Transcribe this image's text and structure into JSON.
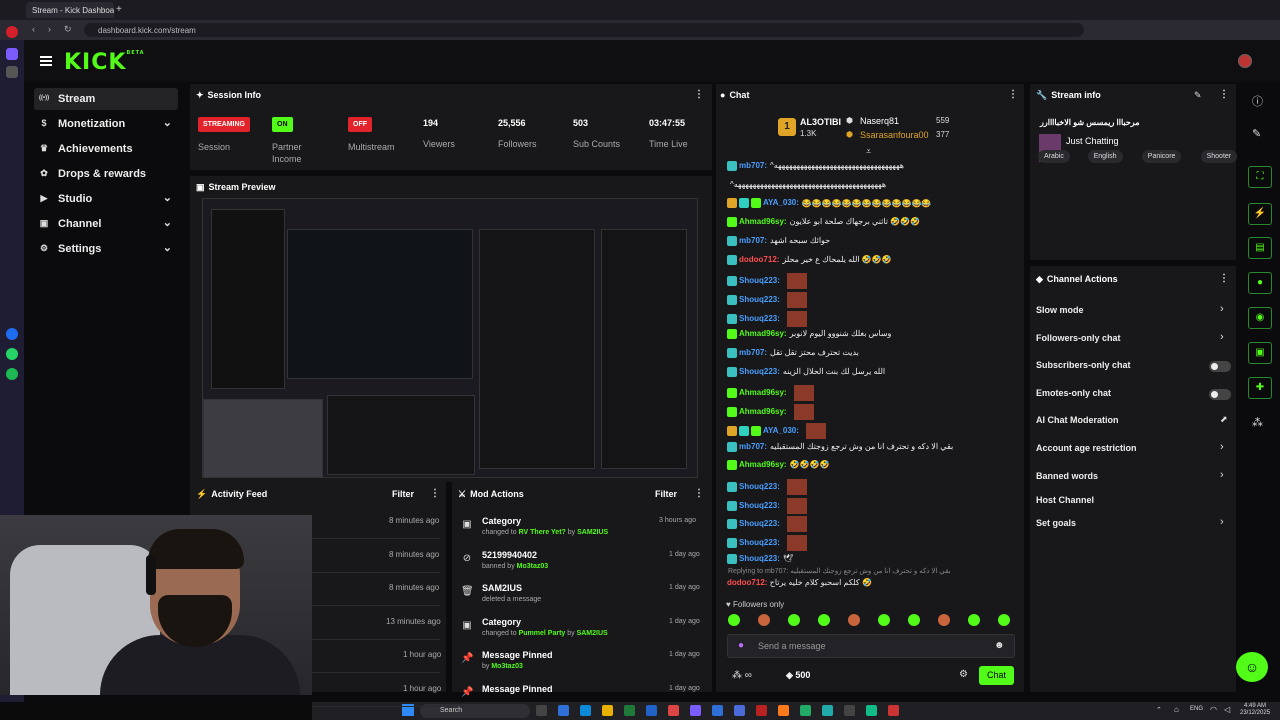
{
  "browser": {
    "tab_title": "Stream - Kick Dashboard",
    "url": "dashboard.kick.com/stream"
  },
  "logo": {
    "text": "KICK",
    "beta": "BETA"
  },
  "nav": [
    {
      "label": "Stream",
      "icon": "stream-icon",
      "active": true
    },
    {
      "label": "Monetization",
      "icon": "dollar-icon",
      "expandable": true
    },
    {
      "label": "Achievements",
      "icon": "trophy-icon"
    },
    {
      "label": "Drops & rewards",
      "icon": "gift-icon"
    },
    {
      "label": "Studio",
      "icon": "studio-icon",
      "expandable": true
    },
    {
      "label": "Channel",
      "icon": "channel-icon",
      "expandable": true
    },
    {
      "label": "Settings",
      "icon": "gear-icon",
      "expandable": true
    }
  ],
  "session": {
    "title": "Session Info",
    "items": [
      {
        "badge": "STREAMING",
        "label": "Session"
      },
      {
        "badge": "ON",
        "label": "Partner Income"
      },
      {
        "badge": "OFF",
        "label": "Multistream"
      }
    ],
    "stats": [
      {
        "value": "194",
        "label": "Viewers"
      },
      {
        "value": "25,556",
        "label": "Followers"
      },
      {
        "value": "503",
        "label": "Sub Counts"
      },
      {
        "value": "03:47:55",
        "label": "Time Live"
      }
    ]
  },
  "preview": {
    "title": "Stream Preview"
  },
  "activity": {
    "title": "Activity Feed",
    "filter": "Filter",
    "times": [
      "8 minutes ago",
      "8 minutes ago",
      "8 minutes ago",
      "13 minutes ago",
      "1 hour ago",
      "1 hour ago"
    ]
  },
  "mod_actions": {
    "title": "Mod Actions",
    "filter": "Filter",
    "items": [
      {
        "title": "Category",
        "pre": "changed to",
        "target": "RV There Yet?",
        "mid": "by",
        "by": "SAM2IUS",
        "time": "3 hours ago",
        "icon": "category-icon"
      },
      {
        "title": "52199940402",
        "pre": "banned by",
        "target": "",
        "mid": "",
        "by": "Mo3taz03",
        "time": "1 day ago",
        "icon": "ban-icon"
      },
      {
        "title": "SAM2IUS",
        "pre": "deleted a message",
        "target": "",
        "mid": "",
        "by": "",
        "time": "1 day ago",
        "icon": "trash-icon"
      },
      {
        "title": "Category",
        "pre": "changed to",
        "target": "Pummel Party",
        "mid": "by",
        "by": "SAM2IUS",
        "time": "1 day ago",
        "icon": "category-icon"
      },
      {
        "title": "Message Pinned",
        "pre": "by",
        "target": "",
        "mid": "",
        "by": "Mo3taz03",
        "time": "1 day ago",
        "icon": "pin-icon"
      },
      {
        "title": "Message Pinned",
        "pre": "",
        "target": "",
        "mid": "",
        "by": "",
        "time": "1 day ago",
        "icon": "pin-icon"
      }
    ]
  },
  "chat": {
    "title": "Chat",
    "leader": {
      "rank": "1",
      "name": "AL3OTIBI",
      "amount": "1.3K"
    },
    "leader2": {
      "name": "Naserq81",
      "amount": "559"
    },
    "leader3": {
      "name": "Ssarasanfoura00",
      "amount": "377"
    },
    "messages": [
      {
        "user": "mb707:",
        "color": "#4a9fff",
        "text": "^ههههههههههههههههههههههههههههههههههه"
      },
      {
        "user": "",
        "color": "#4a9fff",
        "text": "^ههههههههههههههههههههههههههههههههههههههههه"
      },
      {
        "user": "AYA_030:",
        "color": "#4a9fff",
        "text": "😂😂😂😂😂😂😂😂😂😂😂😂😂"
      },
      {
        "user": "Ahmad96sy:",
        "color": "#53fc18",
        "text": "تاثني برجهاك صلحة ابو علايون 🤣🤣🤣"
      },
      {
        "user": "mb707:",
        "color": "#4a9fff",
        "text": "حوائك سبحه اشهد"
      },
      {
        "user": "dodoo712:",
        "color": "#ff4d4d",
        "text": "الله يلمحاك ع خير محلز 🤣🤣🤣"
      },
      {
        "user": "Shouq223:",
        "color": "#4a9fff",
        "text": ""
      },
      {
        "user": "Shouq223:",
        "color": "#4a9fff",
        "text": ""
      },
      {
        "user": "Shouq223:",
        "color": "#4a9fff",
        "text": ""
      },
      {
        "user": "Ahmad96sy:",
        "color": "#53fc18",
        "text": "وساس بغلك شنووو اليوم لانوبر"
      },
      {
        "user": "mb707:",
        "color": "#4a9fff",
        "text": "بديت تحترف محتز تقل تقل"
      },
      {
        "user": "Shouq223:",
        "color": "#4a9fff",
        "text": "الله يرسل لك بنت الحلال الزينه"
      },
      {
        "user": "Ahmad96sy:",
        "color": "#53fc18",
        "text": ""
      },
      {
        "user": "Ahmad96sy:",
        "color": "#53fc18",
        "text": ""
      },
      {
        "user": "AYA_030:",
        "color": "#4a9fff",
        "text": ""
      },
      {
        "user": "mb707:",
        "color": "#4a9fff",
        "text": "بقي الا دكه و تحترف انا من وش ترجع زوجتك المستقبليه"
      },
      {
        "user": "Ahmad96sy:",
        "color": "#53fc18",
        "text": "🤣🤣🤣🤣"
      },
      {
        "user": "Shouq223:",
        "color": "#4a9fff",
        "text": ""
      },
      {
        "user": "Shouq223:",
        "color": "#4a9fff",
        "text": ""
      },
      {
        "user": "Shouq223:",
        "color": "#4a9fff",
        "text": ""
      },
      {
        "user": "Shouq223:",
        "color": "#4a9fff",
        "text": ""
      },
      {
        "user": "Shouq223:",
        "color": "#4a9fff",
        "text": "🕊"
      }
    ],
    "reply": "Replying to mb707: بقي الا دكه و تحترف انا من وش ترجع زوجتك المستقبليه",
    "reply_msg_user": "dodoo712:",
    "reply_msg_text": "كلكم اسحبو كلام خليه يرتاح 🤣",
    "followers_only": "Followers only",
    "placeholder": "Send a message",
    "points": "500",
    "send": "Chat"
  },
  "stream_info": {
    "title": "Stream info",
    "stream_title": "مرحبااا ريمسس شو الاخباااارر",
    "category": "Just Chatting",
    "tags": [
      "Arabic",
      "English",
      "Panicore",
      "Shooter"
    ]
  },
  "channel_actions": {
    "title": "Channel Actions",
    "items": [
      {
        "label": "Slow mode",
        "control": "chevron"
      },
      {
        "label": "Followers-only chat",
        "control": "chevron"
      },
      {
        "label": "Subscribers-only chat",
        "control": "toggle"
      },
      {
        "label": "Emotes-only chat",
        "control": "toggle"
      },
      {
        "label": "AI Chat Moderation",
        "control": "chart"
      },
      {
        "label": "Account age restriction",
        "control": "chevron"
      },
      {
        "label": "Banned words",
        "control": "chevron"
      },
      {
        "label": "Host Channel",
        "control": "none"
      },
      {
        "label": "Set goals",
        "control": "chevron"
      }
    ]
  },
  "taskbar": {
    "search": "Search",
    "lang": "ENG",
    "time": "4:49 AM",
    "date": "23/12/2025"
  },
  "colors": {
    "accent": "#53fc18",
    "red": "#e3232b",
    "panel": "#18181b"
  }
}
